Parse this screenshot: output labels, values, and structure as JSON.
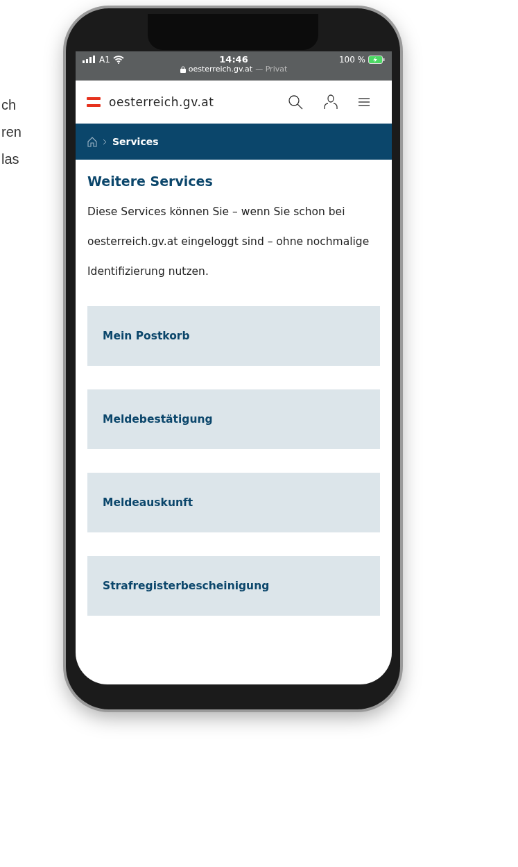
{
  "side_text": [
    "ch",
    "ren",
    "las"
  ],
  "status_bar": {
    "carrier": "A1",
    "time": "14:46",
    "url": "oesterreich.gv.at",
    "mode": "— Privat",
    "battery": "100 %"
  },
  "header": {
    "site_name": "oesterreich.gv.at"
  },
  "breadcrumb": {
    "current": "Services"
  },
  "content": {
    "title": "Weitere Services",
    "intro": "Diese Services können Sie – wenn Sie schon bei oesterreich.gv.at eingeloggt sind – ohne nochmalige Identifizierung nutzen."
  },
  "services": [
    "Mein Postkorb",
    "Meldebestätigung",
    "Meldeauskunft",
    "Strafregisterbescheinigung"
  ]
}
